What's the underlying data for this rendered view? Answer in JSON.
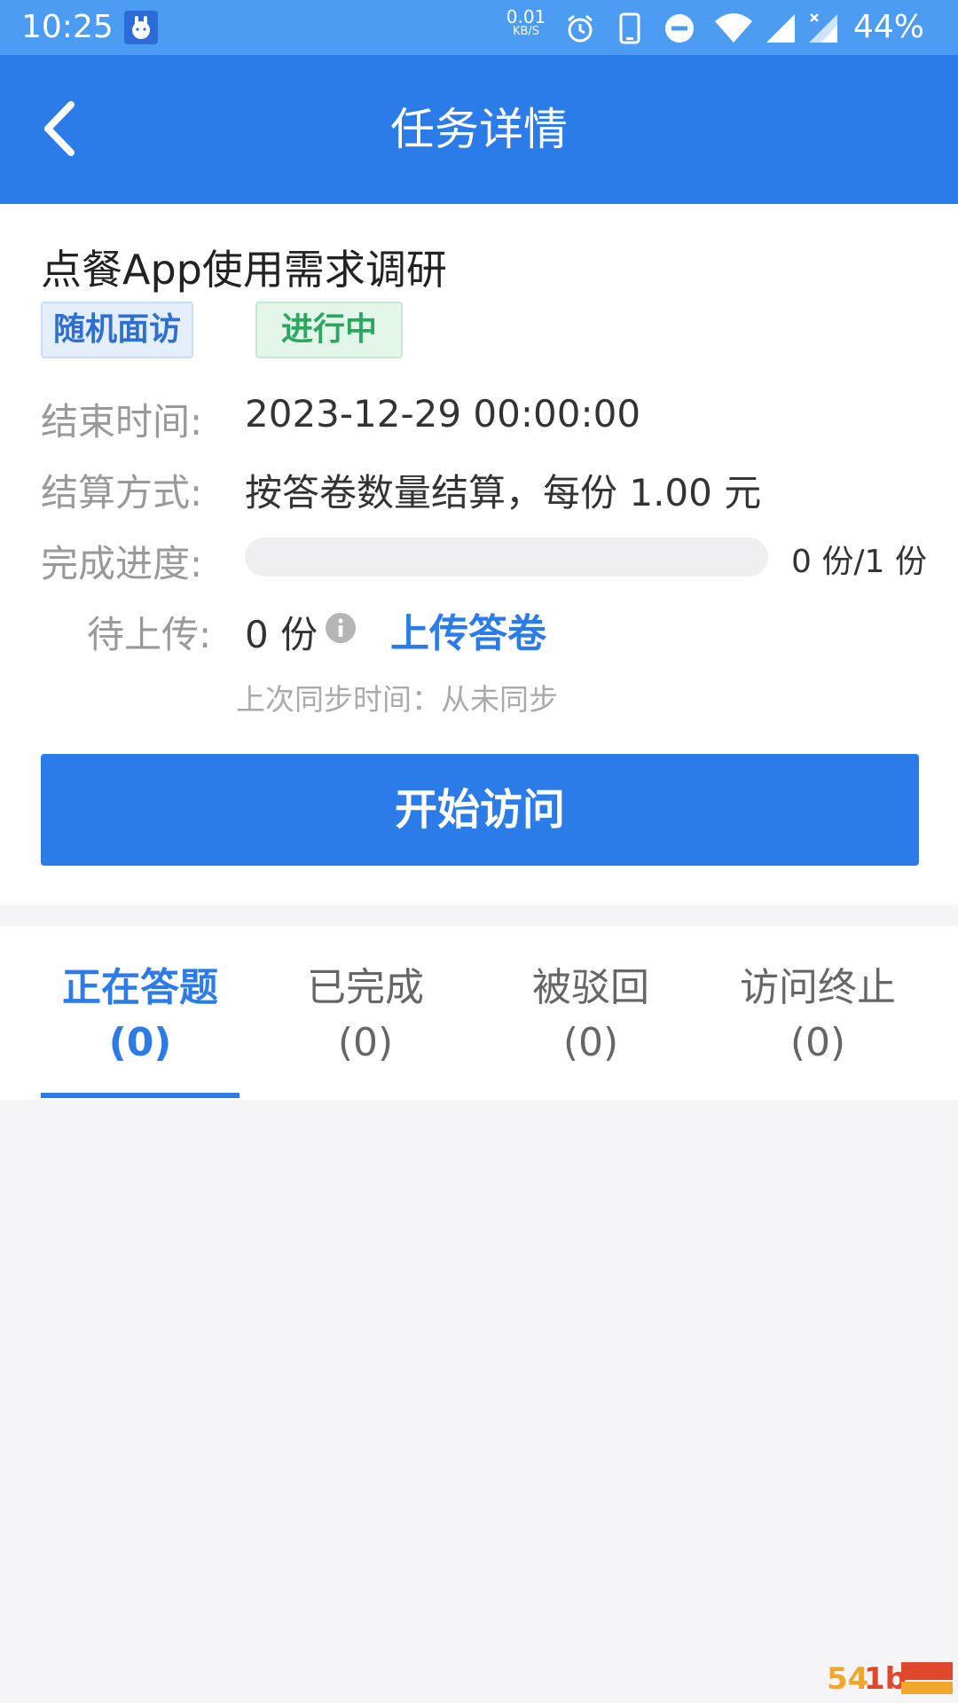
{
  "status_bar": {
    "time": "10:25",
    "net_speed": "0.01",
    "net_unit": "KB/S",
    "battery": "44%",
    "icons": [
      "app-notification-icon",
      "alarm-icon",
      "phone-icon",
      "do-not-disturb-icon",
      "wifi-icon",
      "signal-icon",
      "signal-no-data-icon"
    ]
  },
  "header": {
    "title": "任务详情",
    "back_icon": "chevron-left-icon"
  },
  "task": {
    "title": "点餐App使用需求调研",
    "type_tag": "随机面访",
    "status_tag": "进行中",
    "end_time_label": "结束时间:",
    "end_time_value": "2023-12-29 00:00:00",
    "settlement_label": "结算方式:",
    "settlement_value": "按答卷数量结算，每份 1.00 元",
    "progress_label": "完成进度:",
    "progress_fraction": 0,
    "progress_text": "0 份/1 份",
    "pending_label": "待上传:",
    "pending_value": "0 份",
    "info_icon": "info-icon",
    "upload_link": "上传答卷",
    "last_sync": "上次同步时间：从未同步"
  },
  "primary_button": "开始访问",
  "tabs": [
    {
      "label": "正在答题",
      "count": "(0)"
    },
    {
      "label": "已完成",
      "count": "(0)"
    },
    {
      "label": "被驳回",
      "count": "(0)"
    },
    {
      "label": "访问终止",
      "count": "(0)"
    }
  ],
  "colors": {
    "primary": "#2b7be8",
    "status_bar": "#4b9cf2",
    "status_green": "#2ba860",
    "background": "#f5f5f7"
  }
}
